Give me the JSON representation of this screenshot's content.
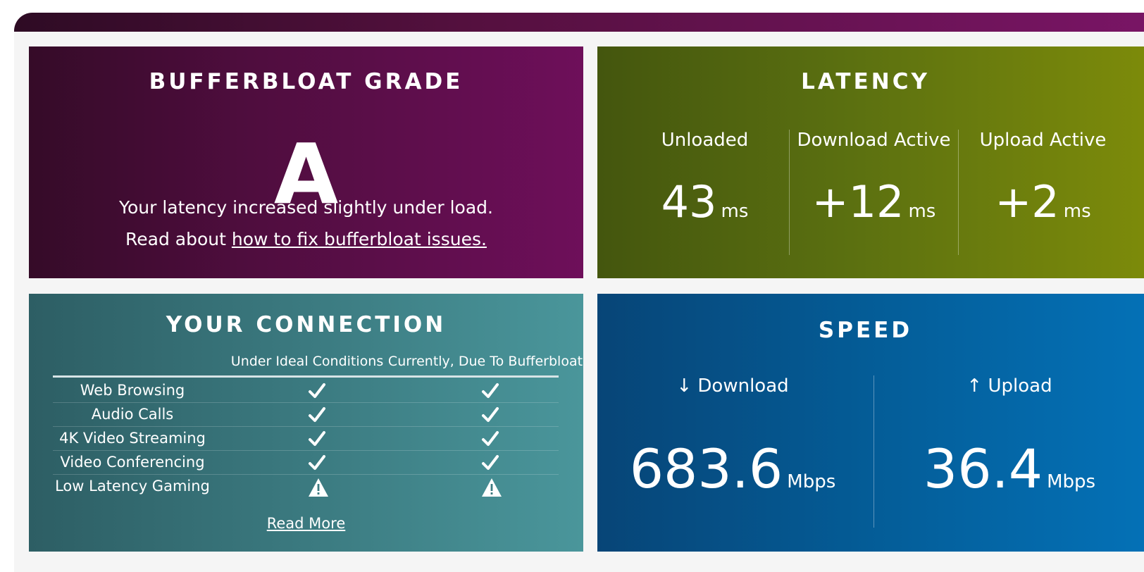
{
  "grade": {
    "title": "BUFFERBLOAT GRADE",
    "letter": "A",
    "description": "Your latency increased slightly under load.",
    "read_prefix": "Read about ",
    "link_text": "how to fix bufferbloat issues."
  },
  "latency": {
    "title": "LATENCY",
    "columns": [
      {
        "label": "Unloaded",
        "value": "43",
        "unit": "ms"
      },
      {
        "label": "Download Active",
        "value": "+12",
        "unit": "ms"
      },
      {
        "label": "Upload Active",
        "value": "+2",
        "unit": "ms"
      }
    ]
  },
  "connection": {
    "title": "YOUR CONNECTION",
    "headers": [
      "Under Ideal Conditions",
      "Currently, Due To Bufferbloat"
    ],
    "rows": [
      {
        "label": "Web Browsing",
        "ideal": "check-icon",
        "current": "check-icon"
      },
      {
        "label": "Audio Calls",
        "ideal": "check-icon",
        "current": "check-icon"
      },
      {
        "label": "4K Video Streaming",
        "ideal": "check-icon",
        "current": "check-icon"
      },
      {
        "label": "Video Conferencing",
        "ideal": "check-icon",
        "current": "check-icon"
      },
      {
        "label": "Low Latency Gaming",
        "ideal": "warning-icon",
        "current": "warning-icon"
      }
    ],
    "read_more": "Read More"
  },
  "speed": {
    "title": "SPEED",
    "download": {
      "label": "↓ Download",
      "value": "683.6",
      "unit": "Mbps"
    },
    "upload": {
      "label": "↑ Upload",
      "value": "36.4",
      "unit": "Mbps"
    }
  }
}
